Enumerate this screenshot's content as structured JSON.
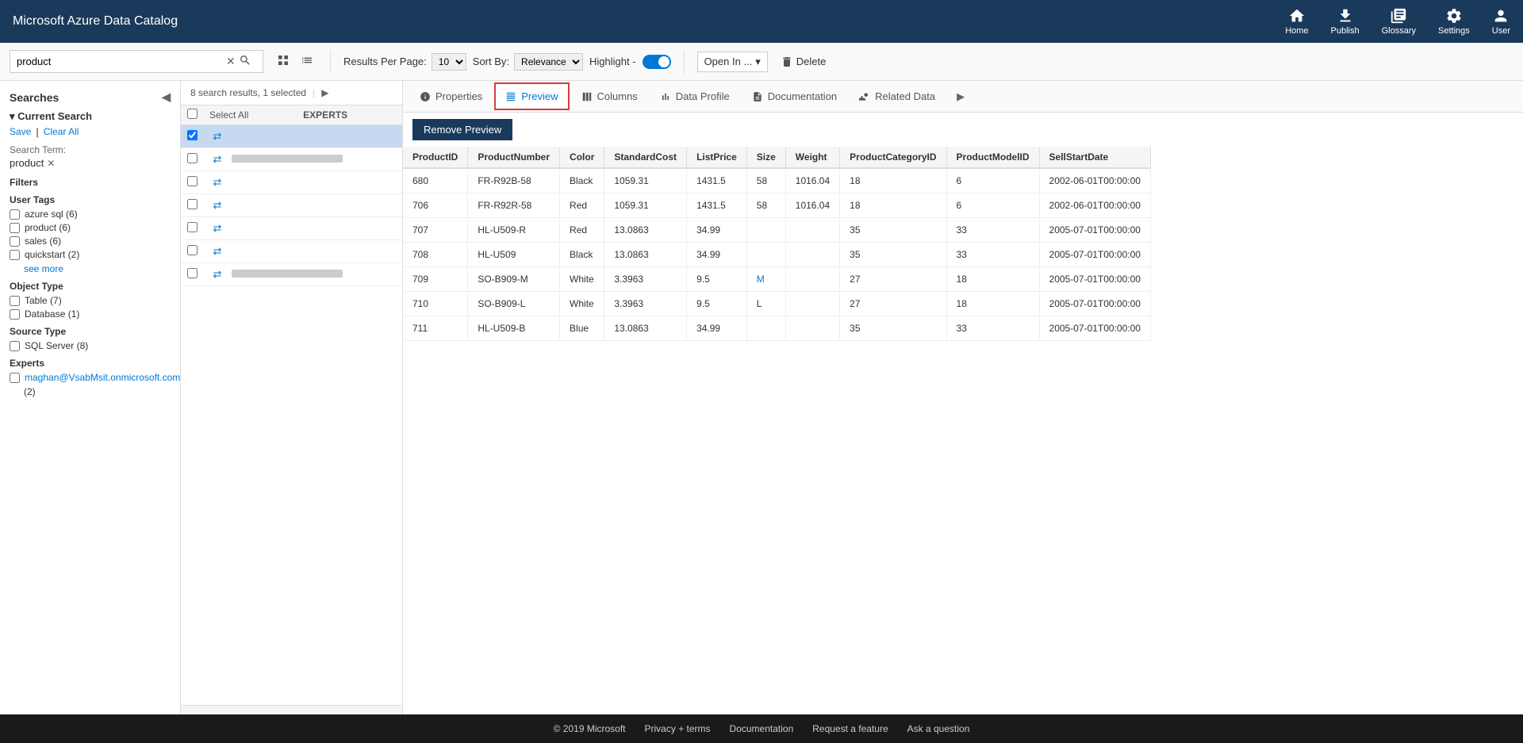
{
  "app": {
    "title": "Microsoft Azure Data Catalog"
  },
  "nav": {
    "items": [
      {
        "id": "home",
        "label": "Home",
        "icon": "home"
      },
      {
        "id": "publish",
        "label": "Publish",
        "icon": "publish"
      },
      {
        "id": "glossary",
        "label": "Glossary",
        "icon": "glossary"
      },
      {
        "id": "settings",
        "label": "Settings",
        "icon": "settings"
      },
      {
        "id": "user",
        "label": "User",
        "icon": "user"
      }
    ]
  },
  "toolbar": {
    "search_value": "product",
    "results_per_page_label": "Results Per Page:",
    "results_per_page_value": "10",
    "sort_by_label": "Sort By:",
    "sort_by_value": "Relevance",
    "highlight_label": "Highlight -",
    "open_in_label": "Open In ...",
    "delete_label": "Delete"
  },
  "sidebar": {
    "header": "Searches",
    "current_search_label": "Current Search",
    "save_label": "Save",
    "clear_all_label": "Clear All",
    "search_term_label": "Search Term:",
    "search_term_value": "product",
    "filters_label": "Filters",
    "user_tags_label": "User Tags",
    "user_tags": [
      {
        "name": "azure sql",
        "count": 6
      },
      {
        "name": "product",
        "count": 6
      },
      {
        "name": "sales",
        "count": 6
      },
      {
        "name": "quickstart",
        "count": 2
      }
    ],
    "see_more_label": "see more",
    "object_type_label": "Object Type",
    "object_types": [
      {
        "name": "Table",
        "count": 7
      },
      {
        "name": "Database",
        "count": 1
      }
    ],
    "source_type_label": "Source Type",
    "source_types": [
      {
        "name": "SQL Server",
        "count": 8
      }
    ],
    "experts_label": "Experts",
    "experts_email": "maghan@VsabMsit.onmicrosoft.com",
    "experts_count": "(2)"
  },
  "results": {
    "summary": "8 search results, 1 selected",
    "select_all_label": "Select All",
    "experts_col_label": "EXPERTS",
    "rows": [
      {
        "id": 1,
        "selected": true,
        "has_name": false
      },
      {
        "id": 2,
        "selected": false,
        "has_name": true
      },
      {
        "id": 3,
        "selected": false,
        "has_name": false
      },
      {
        "id": 4,
        "selected": false,
        "has_name": false
      },
      {
        "id": 5,
        "selected": false,
        "has_name": false
      },
      {
        "id": 6,
        "selected": false,
        "has_name": false
      },
      {
        "id": 7,
        "selected": false,
        "has_name": true
      }
    ]
  },
  "detail": {
    "tabs": [
      {
        "id": "properties",
        "label": "Properties",
        "active": false
      },
      {
        "id": "preview",
        "label": "Preview",
        "active": true
      },
      {
        "id": "columns",
        "label": "Columns",
        "active": false
      },
      {
        "id": "data-profile",
        "label": "Data Profile",
        "active": false
      },
      {
        "id": "documentation",
        "label": "Documentation",
        "active": false
      },
      {
        "id": "related-data",
        "label": "Related Data",
        "active": false
      }
    ],
    "remove_preview_label": "Remove Preview",
    "table_columns": [
      "ProductID",
      "ProductNumber",
      "Color",
      "StandardCost",
      "ListPrice",
      "Size",
      "Weight",
      "ProductCategoryID",
      "ProductModelID",
      "SellStartDate"
    ],
    "table_rows": [
      {
        "ProductID": "680",
        "ProductNumber": "FR-R92B-58",
        "Color": "Black",
        "StandardCost": "1059.31",
        "ListPrice": "1431.5",
        "Size": "58",
        "Weight": "1016.04",
        "ProductCategoryID": "18",
        "ProductModelID": "6",
        "SellStartDate": "2002-06-01T00:00:00"
      },
      {
        "ProductID": "706",
        "ProductNumber": "FR-R92R-58",
        "Color": "Red",
        "StandardCost": "1059.31",
        "ListPrice": "1431.5",
        "Size": "58",
        "Weight": "1016.04",
        "ProductCategoryID": "18",
        "ProductModelID": "6",
        "SellStartDate": "2002-06-01T00:00:00"
      },
      {
        "ProductID": "707",
        "ProductNumber": "HL-U509-R",
        "Color": "Red",
        "StandardCost": "13.0863",
        "ListPrice": "34.99",
        "Size": "",
        "Weight": "",
        "ProductCategoryID": "35",
        "ProductModelID": "33",
        "SellStartDate": "2005-07-01T00:00:00"
      },
      {
        "ProductID": "708",
        "ProductNumber": "HL-U509",
        "Color": "Black",
        "StandardCost": "13.0863",
        "ListPrice": "34.99",
        "Size": "",
        "Weight": "",
        "ProductCategoryID": "35",
        "ProductModelID": "33",
        "SellStartDate": "2005-07-01T00:00:00"
      },
      {
        "ProductID": "709",
        "ProductNumber": "SO-B909-M",
        "Color": "White",
        "StandardCost": "3.3963",
        "ListPrice": "9.5",
        "Size": "M",
        "Weight": "",
        "ProductCategoryID": "27",
        "ProductModelID": "18",
        "SellStartDate": "2005-07-01T00:00:00",
        "size_link": true
      },
      {
        "ProductID": "710",
        "ProductNumber": "SO-B909-L",
        "Color": "White",
        "StandardCost": "3.3963",
        "ListPrice": "9.5",
        "Size": "L",
        "Weight": "",
        "ProductCategoryID": "27",
        "ProductModelID": "18",
        "SellStartDate": "2005-07-01T00:00:00"
      },
      {
        "ProductID": "711",
        "ProductNumber": "HL-U509-B",
        "Color": "Blue",
        "StandardCost": "13.0863",
        "ListPrice": "34.99",
        "Size": "",
        "Weight": "",
        "ProductCategoryID": "35",
        "ProductModelID": "33",
        "SellStartDate": "2005-07-01T00:00:00"
      }
    ]
  },
  "footer": {
    "copyright": "© 2019 Microsoft",
    "privacy_label": "Privacy + terms",
    "documentation_label": "Documentation",
    "request_label": "Request a feature",
    "ask_label": "Ask a question"
  }
}
